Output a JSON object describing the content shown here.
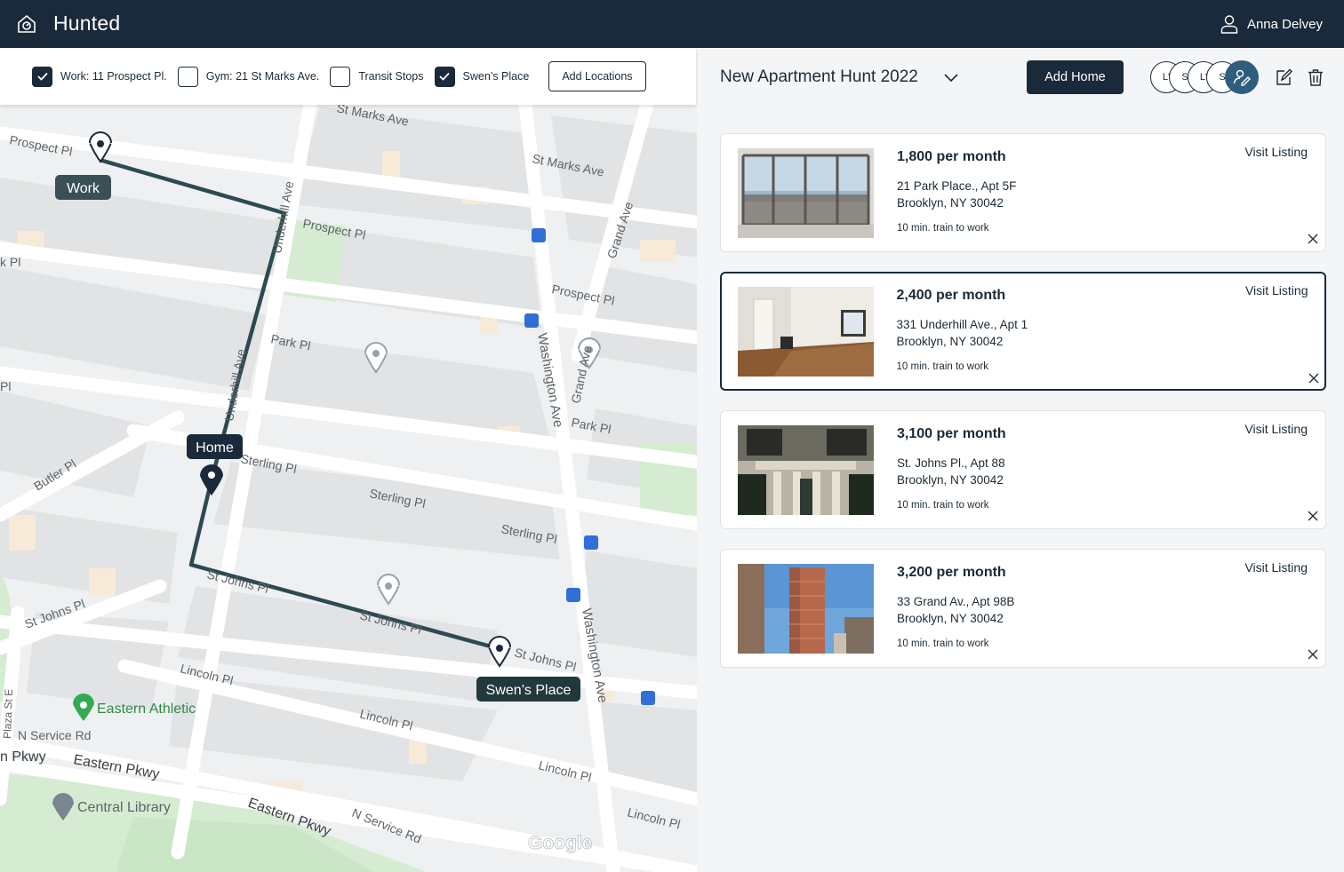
{
  "app": {
    "title": "Hunted",
    "logo_icon": "home-icon"
  },
  "user": {
    "name": "Anna Delvey",
    "icon": "person-icon"
  },
  "filters": [
    {
      "label": "Work: 11 Prospect Pl.",
      "checked": true
    },
    {
      "label": "Gym: 21 St Marks Ave.",
      "checked": false
    },
    {
      "label": "Transit Stops",
      "checked": false
    },
    {
      "label": "Swen’s Place",
      "checked": true
    }
  ],
  "add_locations_label": "Add Locations",
  "map": {
    "markers": {
      "work": "Work",
      "home": "Home",
      "swen": "Swen’s Place"
    },
    "places": {
      "eastern_athletic": "Eastern Athletic",
      "central_library": "Central Library"
    },
    "streets": {
      "prospect_pl": "Prospect Pl",
      "st_marks_ave": "St Marks Ave",
      "underhill_ave": "Underhill Ave",
      "grand_ave": "Grand Ave",
      "park_pl": "Park Pl",
      "washington_ave": "Washington Ave",
      "sterling_pl": "Sterling Pl",
      "butler_pl": "Butler Pl",
      "st_johns_pl": "St Johns Pl",
      "lincoln_pl": "Lincoln Pl",
      "n_service_rd": "N Service Rd",
      "eastern_pkwy": "Eastern Pkwy",
      "plaza_st_e": "Plaza St E",
      "k_pl": "k Pl",
      "n_pkwy": "n Pkwy",
      "pl": "Pl"
    },
    "attribution": "Google"
  },
  "hunt": {
    "title": "New Apartment Hunt 2022"
  },
  "add_home_label": "Add Home",
  "collaborators": [
    "L'",
    "S",
    "L'",
    "S"
  ],
  "accent_color": "#1b2a3a",
  "route_color": "#2c4a52",
  "listings": [
    {
      "price": "1,800 per month",
      "address1": "21 Park Place., Apt 5F",
      "address2": "Brooklyn, NY 30042",
      "commute": "10 min. train to work",
      "visit_label": "Visit Listing",
      "selected": false
    },
    {
      "price": "2,400 per month",
      "address1": "331 Underhill Ave., Apt 1",
      "address2": "Brooklyn, NY 30042",
      "commute": "10 min. train to work",
      "visit_label": "Visit Listing",
      "selected": true
    },
    {
      "price": "3,100 per month",
      "address1": "St. Johns Pl., Apt 88",
      "address2": "Brooklyn, NY 30042",
      "commute": "10 min. train to work",
      "visit_label": "Visit Listing",
      "selected": false
    },
    {
      "price": "3,200 per month",
      "address1": "33 Grand Av., Apt 98B",
      "address2": "Brooklyn, NY 30042",
      "commute": "10 min. train to work",
      "visit_label": "Visit Listing",
      "selected": false
    }
  ]
}
